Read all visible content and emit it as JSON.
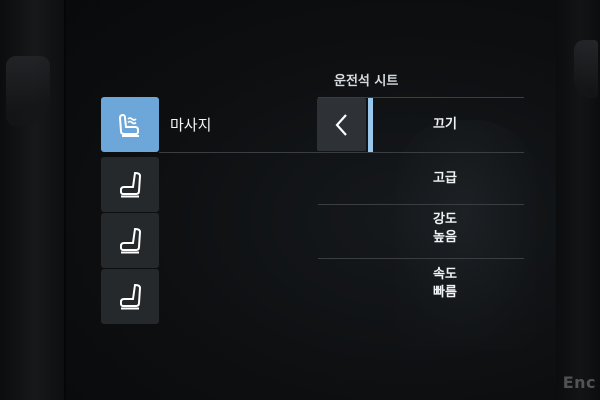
{
  "header": {
    "title": "운전석 시트"
  },
  "function": {
    "label": "마사지"
  },
  "seat_buttons": [
    {
      "name": "massage",
      "icon": "seat-massage-icon",
      "active": true
    },
    {
      "name": "seat-function-2",
      "icon": "seat-icon",
      "active": false
    },
    {
      "name": "seat-function-3",
      "icon": "seat-icon",
      "active": false
    },
    {
      "name": "seat-function-4",
      "icon": "seat-icon",
      "active": false
    }
  ],
  "options": {
    "off": "끄기",
    "program": "고급",
    "intensity": {
      "line1": "강도",
      "line2": "높음"
    },
    "speed": {
      "line1": "속도",
      "line2": "빠름"
    }
  },
  "watermark": "Enc",
  "colors": {
    "active": "#6da6d8",
    "indicator": "#9ac7ec",
    "button_bg": "#26292c"
  }
}
